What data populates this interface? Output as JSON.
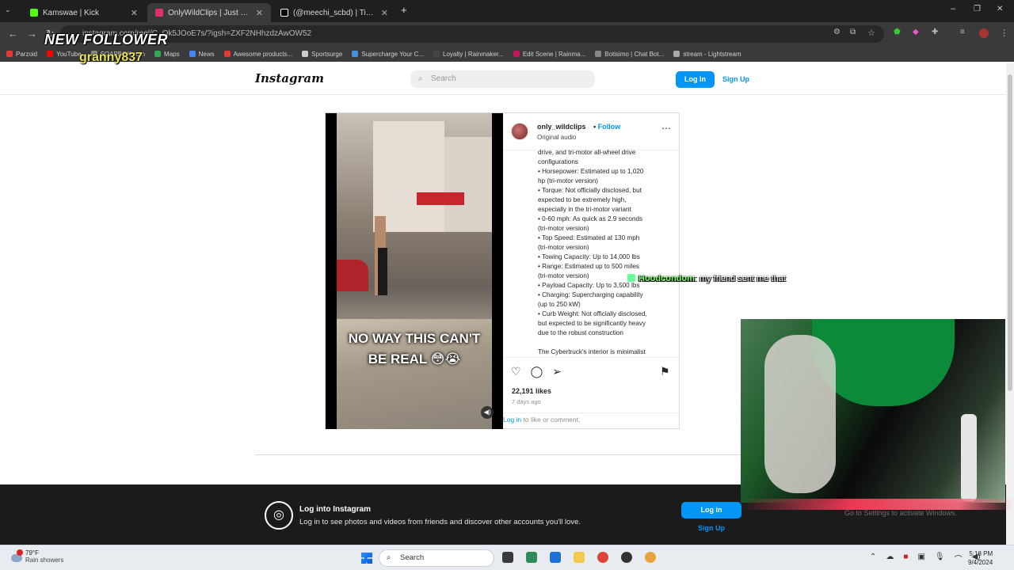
{
  "tabs": [
    {
      "label": "Kamswae | Kick",
      "color": "#53fc18",
      "active": false
    },
    {
      "label": "OnlyWildClips | Just another da",
      "color": "#e1306c",
      "active": true
    },
    {
      "label": "(@meechi_scbd) | TikTok",
      "color": "#ffffff",
      "active": false
    }
  ],
  "address": {
    "url": "instagram.com/reel/C_Ok5JOoE7s/?igsh=ZXF2NHhzdzAwOW52"
  },
  "bookmarks": [
    {
      "label": "Parzoid",
      "color": "#e53935"
    },
    {
      "label": "YouTube",
      "color": "#ff0000"
    },
    {
      "label": "SOAPBOX.com",
      "color": "#888888"
    },
    {
      "label": "Maps",
      "color": "#34a853"
    },
    {
      "label": "News",
      "color": "#4285f4"
    },
    {
      "label": "Awesome products...",
      "color": "#e53935"
    },
    {
      "label": "Sportsurge",
      "color": "#cccccc"
    },
    {
      "label": "Supercharge Your C...",
      "color": "#4a90e2"
    },
    {
      "label": "Loyalty | Rainmaker...",
      "color": "#444444"
    },
    {
      "label": "Edit Scene | Rainma...",
      "color": "#c2185b"
    },
    {
      "label": "Botisimo | Chat Bot...",
      "color": "#888888"
    },
    {
      "label": "stream - Lightstream",
      "color": "#aaaaaa"
    }
  ],
  "instagram": {
    "logo": "Instagram",
    "search_placeholder": "Search",
    "login_label": "Log In",
    "signup_label": "Sign Up"
  },
  "post": {
    "username": "only_wildclips",
    "follow_label": "Follow",
    "separator": "•",
    "audio": "Original audio",
    "video_caption_line1": "NO WAY THIS CAN'T",
    "video_caption_line2": "BE REAL 😳😭",
    "description_lines": [
      "drive, and tri-motor all-wheel drive",
      "configurations",
      "• Horsepower: Estimated up to 1,020",
      "hp (tri-motor version)",
      "• Torque: Not officially disclosed, but",
      "expected to be extremely high,",
      "especially in the tri-motor variant",
      "• 0-60 mph: As quick as 2.9 seconds",
      "(tri-motor version)",
      "• Top Speed: Estimated at 130 mph",
      "(tri-motor version)",
      "• Towing Capacity: Up to 14,000 lbs",
      "• Range: Estimated up to 500 miles",
      "(tri-motor version)",
      "• Payload Capacity: Up to 3,500 lbs",
      "• Charging: Supercharging capability",
      "(up to 250 kW)",
      "• Curb Weight: Not officially disclosed,",
      "but expected to be significantly heavy",
      "due to the robust construction",
      "",
      "The Cybertruck's interior is minimalist"
    ],
    "likes": "22,191 likes",
    "posted": "7 days ago",
    "comment_link": "Log in",
    "comment_rest": " to like or comment."
  },
  "banner": {
    "title": "Log into Instagram",
    "subtitle": "Log in to see photos and videos from friends and discover other accounts you'll love.",
    "login_label": "Log in",
    "signup_label": "Sign Up"
  },
  "overlay": {
    "follower_alert": "NEW FOLLOWER",
    "follower_name": "granny837",
    "chat_user": "Hoodcondom",
    "chat_text": ": my friend sent me that",
    "watermark": "Go to Settings to activate Windows."
  },
  "taskbar": {
    "temperature": "79°F",
    "weather": "Rain showers",
    "search_placeholder": "Search",
    "time": "5:18 PM",
    "date": "9/4/2024"
  }
}
